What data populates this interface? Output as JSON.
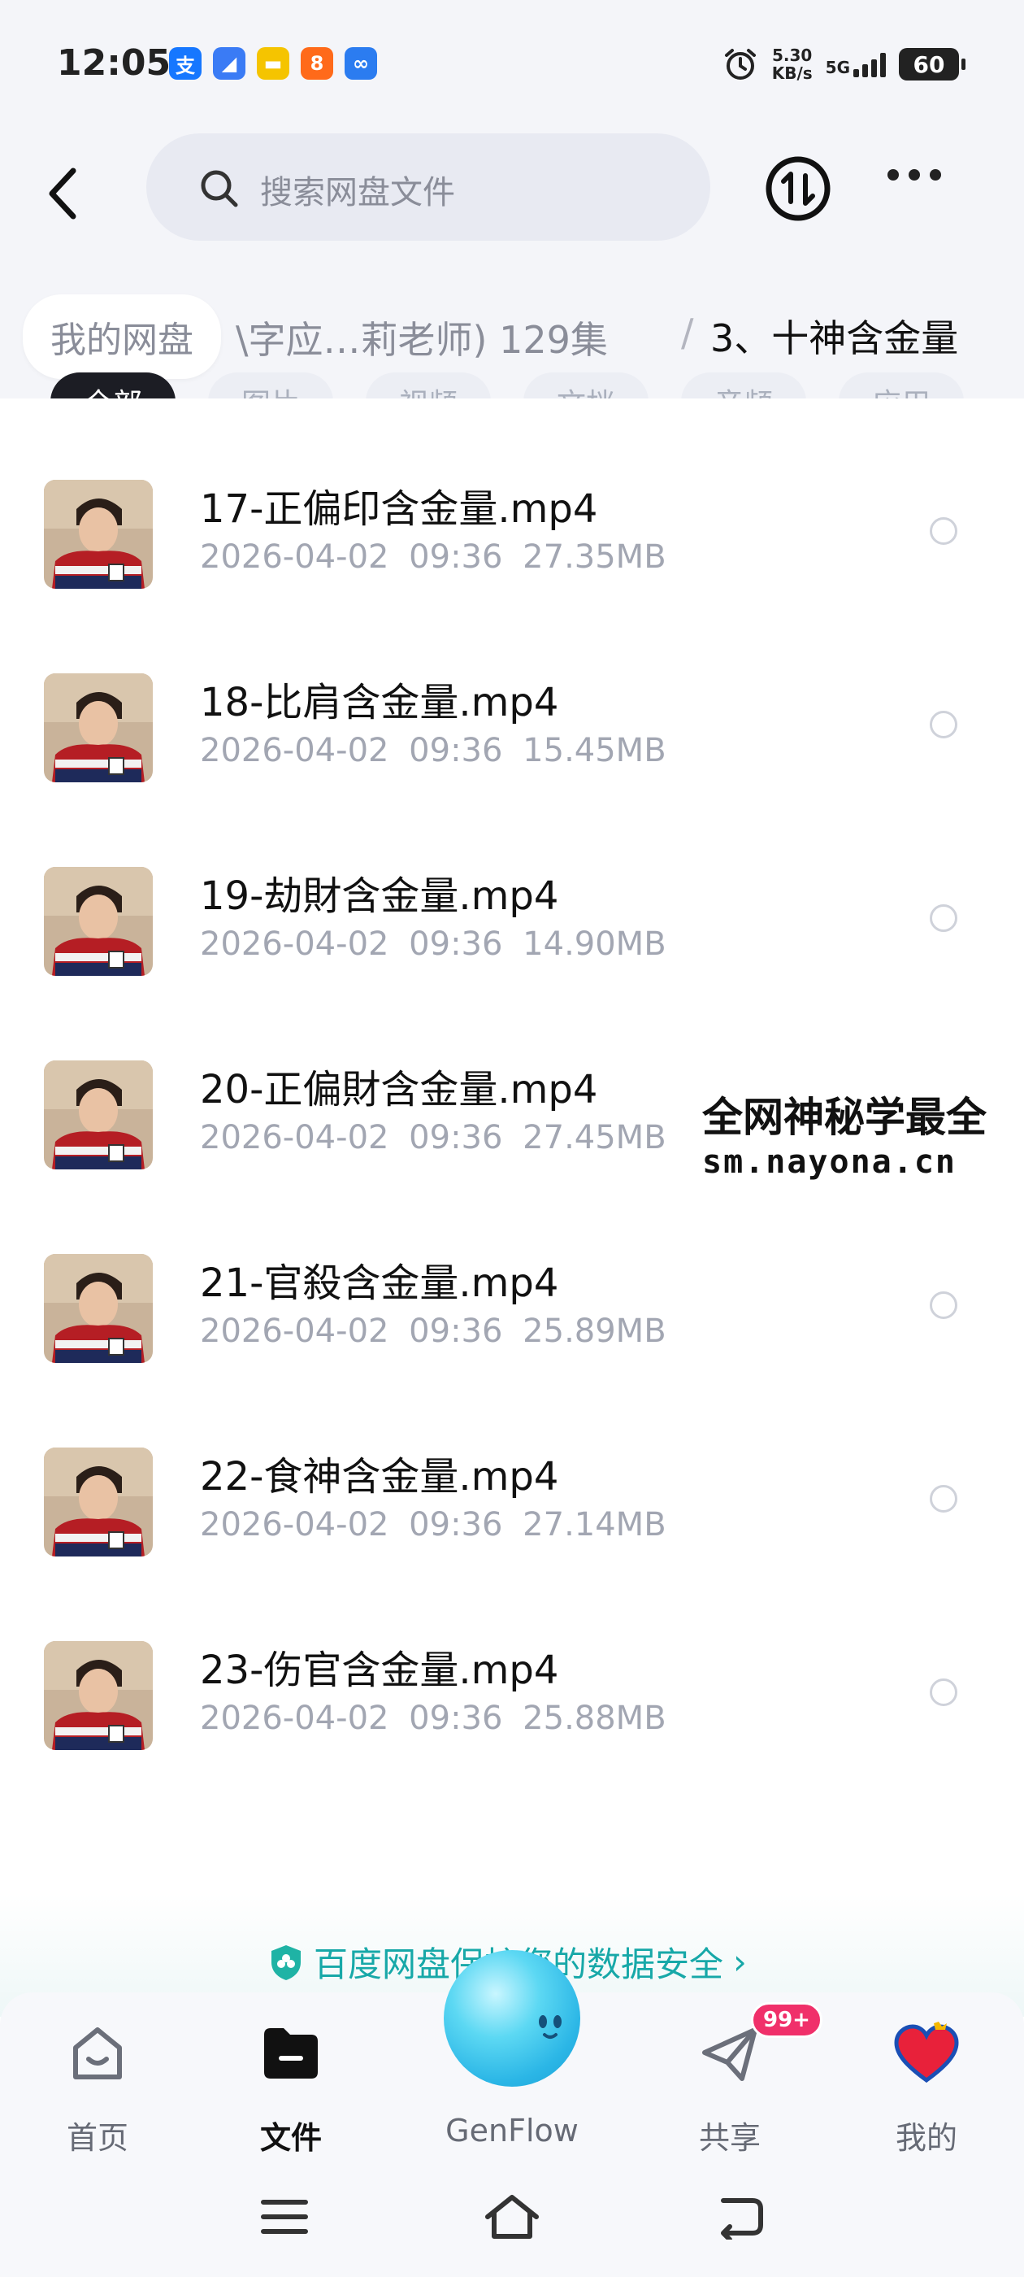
{
  "status_bar": {
    "time": "12:05",
    "net_speed_value": "5.30",
    "net_speed_unit": "KB/s",
    "network": "5G",
    "battery": "60",
    "app_icons": [
      {
        "name": "alipay-icon",
        "glyph": "支",
        "color": "#1677ff"
      },
      {
        "name": "app-blue-icon",
        "glyph": "◢",
        "color": "#3a7bf5"
      },
      {
        "name": "app-card-icon",
        "glyph": "▬",
        "color": "#f5c400"
      },
      {
        "name": "app-orange-icon",
        "glyph": "8",
        "color": "#ff6a1a"
      },
      {
        "name": "genflow-small-icon",
        "glyph": "∞",
        "color": "#2b7cf0"
      }
    ]
  },
  "header": {
    "search_placeholder": "搜索网盘文件"
  },
  "breadcrumb": {
    "root": "我的网盘",
    "middle": "\\字应…莉老师) 129集",
    "separator": "/",
    "current": "3、十神含金量"
  },
  "tabs": [
    {
      "label": "全部",
      "active": true
    },
    {
      "label": "图片",
      "active": false
    },
    {
      "label": "视频",
      "active": false
    },
    {
      "label": "文档",
      "active": false
    },
    {
      "label": "音频",
      "active": false
    },
    {
      "label": "应用",
      "active": false
    }
  ],
  "files": [
    {
      "name": "17-正偏印含金量.mp4",
      "meta": "2026-04-02 09:36 27.35MB"
    },
    {
      "name": "18-比肩含金量.mp4",
      "meta": "2026-04-02 09:36 15.45MB"
    },
    {
      "name": "19-劫財含金量.mp4",
      "meta": "2026-04-02 09:36 14.90MB"
    },
    {
      "name": "20-正偏財含金量.mp4",
      "meta": "2026-04-02 09:36 27.45MB"
    },
    {
      "name": "21-官殺含金量.mp4",
      "meta": "2026-04-02 09:36 25.89MB"
    },
    {
      "name": "22-食神含金量.mp4",
      "meta": "2026-04-02 09:36 27.14MB"
    },
    {
      "name": "23-伤官含金量.mp4",
      "meta": "2026-04-02 09:36 25.88MB"
    }
  ],
  "watermark": {
    "title": "全网神秘学最全",
    "url": "sm.nayona.cn"
  },
  "security_banner": {
    "text": "百度网盘保护您的数据安全",
    "arrow": "›"
  },
  "bottom_nav": {
    "home": "首页",
    "files": "文件",
    "genflow": "GenFlow",
    "share": "共享",
    "share_badge": "99+",
    "me": "我的"
  }
}
